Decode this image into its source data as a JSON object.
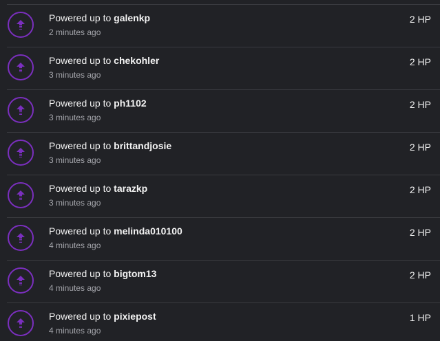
{
  "activity": {
    "items": [
      {
        "prefix": "Powered up to ",
        "user": "galenkp",
        "time": "2 minutes ago",
        "amount": "2 HP"
      },
      {
        "prefix": "Powered up to ",
        "user": "chekohler",
        "time": "3 minutes ago",
        "amount": "2 HP"
      },
      {
        "prefix": "Powered up to ",
        "user": "ph1102",
        "time": "3 minutes ago",
        "amount": "2 HP"
      },
      {
        "prefix": "Powered up to ",
        "user": "brittandjosie",
        "time": "3 minutes ago",
        "amount": "2 HP"
      },
      {
        "prefix": "Powered up to ",
        "user": "tarazkp",
        "time": "3 minutes ago",
        "amount": "2 HP"
      },
      {
        "prefix": "Powered up to ",
        "user": "melinda010100",
        "time": "4 minutes ago",
        "amount": "2 HP"
      },
      {
        "prefix": "Powered up to ",
        "user": "bigtom13",
        "time": "4 minutes ago",
        "amount": "2 HP"
      },
      {
        "prefix": "Powered up to ",
        "user": "pixiepost",
        "time": "4 minutes ago",
        "amount": "1 HP"
      }
    ]
  },
  "icons": {
    "power_up": "power-up-arrow-icon"
  },
  "colors": {
    "background": "#212226",
    "accent": "#7b2fbf",
    "text": "#f3f3f3",
    "muted": "#a4a5ab",
    "divider": "#3a3b40"
  }
}
